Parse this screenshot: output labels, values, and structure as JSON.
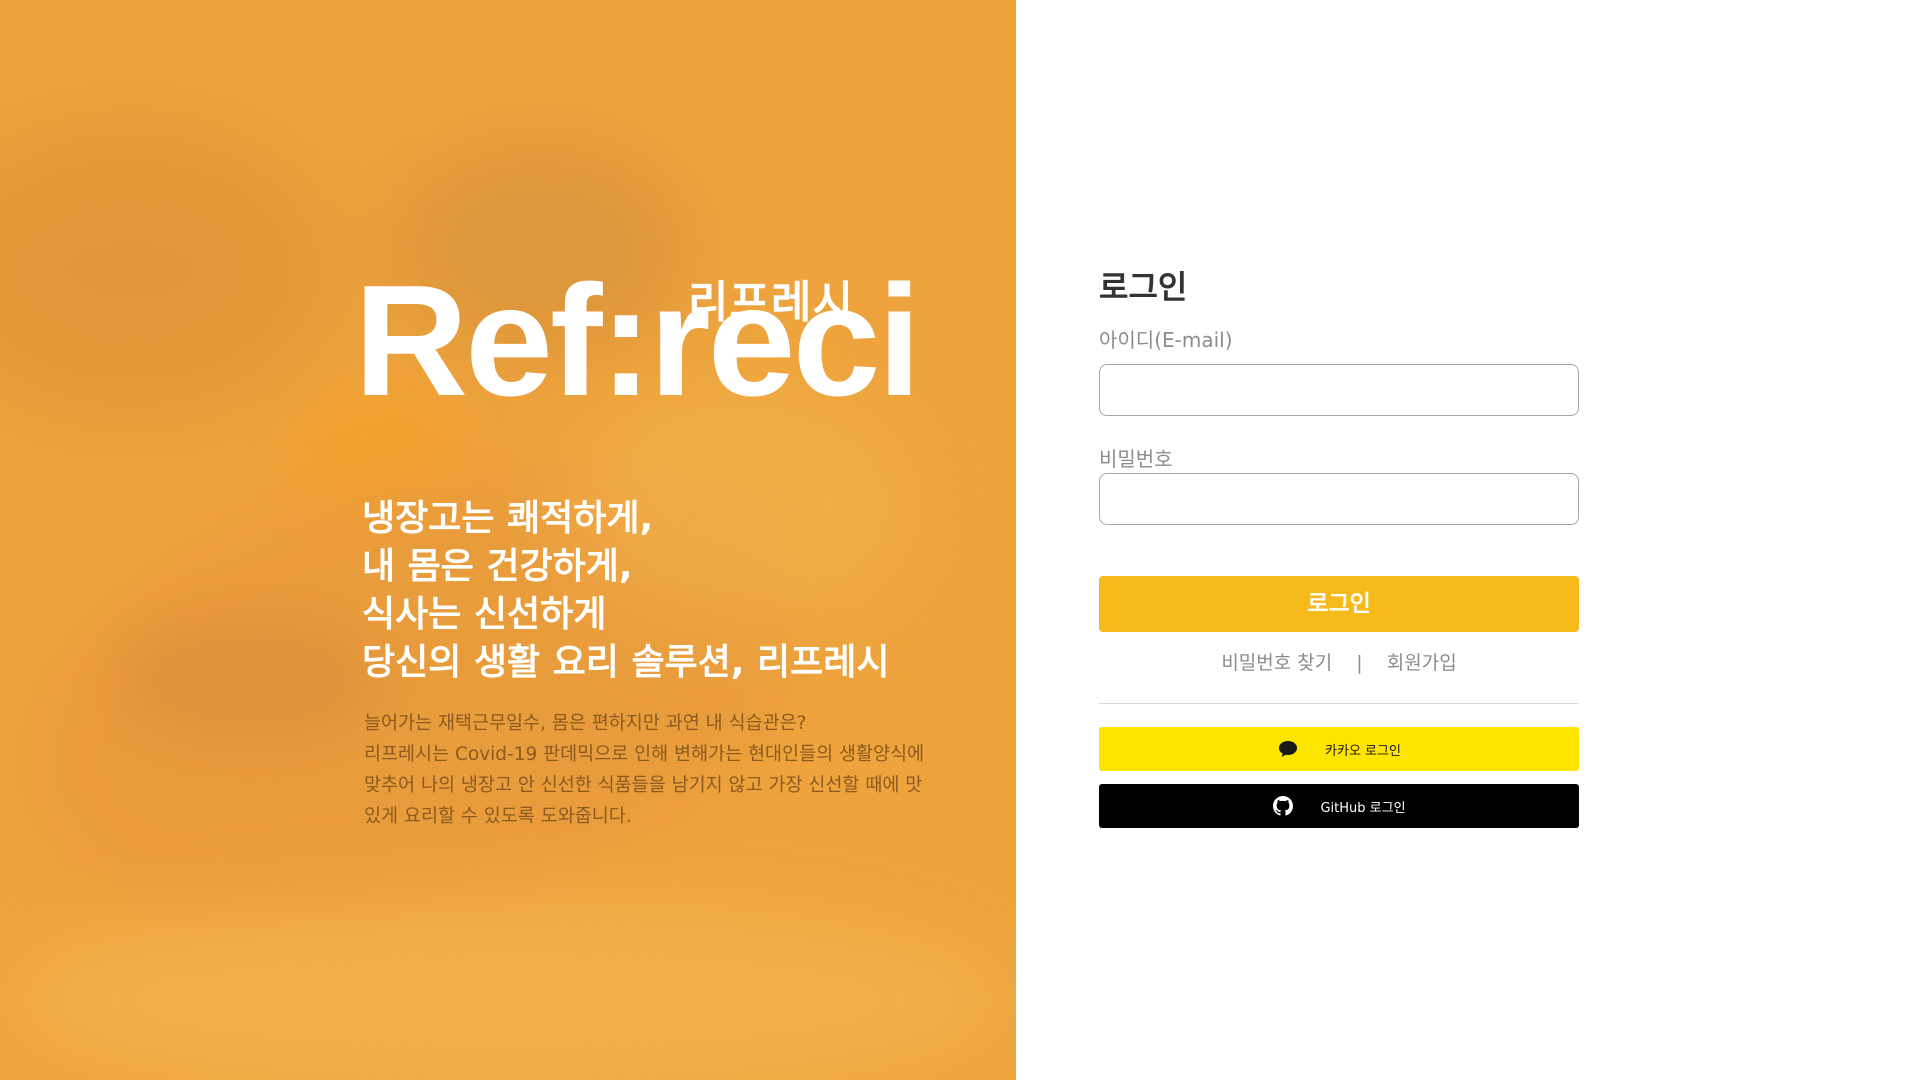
{
  "hero": {
    "logo_text": "Ref:reci",
    "logo_korean": "리프레시",
    "slogan": [
      "냉장고는 쾌적하게,",
      "내 몸은 건강하게,",
      "식사는 신선하게",
      "당신의 생활 요리 솔루션, 리프레시"
    ],
    "description": [
      "늘어가는 재택근무일수, 몸은 편하지만 과연 내 식습관은?",
      "리프레시는 Covid-19 판데믹으로 인해 변해가는 현대인들의 생활양식에",
      "맞추어 나의 냉장고 안 신선한 식품들을 남기지 않고 가장 신선할 때에 맛",
      "있게 요리할 수 있도록 도와줍니다."
    ],
    "overlay_color": "#eea33c"
  },
  "login": {
    "title": "로그인",
    "id_label": "아이디(E-mail)",
    "id_value": "",
    "id_placeholder": "",
    "password_label": "비밀번호",
    "password_value": "",
    "password_placeholder": "",
    "submit_label": "로그인",
    "find_password": "비밀번호 찾기",
    "separator": "|",
    "signup": "회원가입",
    "kakao_label": "카카오 로그인",
    "kakao_icon": "speech-bubble-icon",
    "github_label": "GitHub 로그인",
    "github_icon": "github-icon",
    "accent_color": "#f6bb1a",
    "kakao_color": "#fee500",
    "github_color": "#000000"
  }
}
